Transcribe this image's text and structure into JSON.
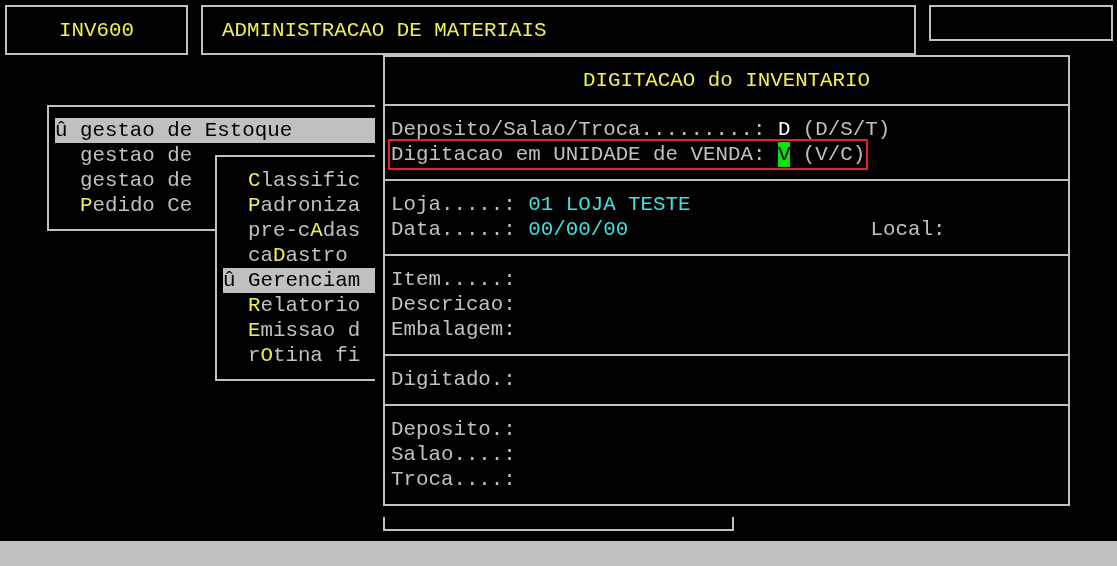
{
  "header": {
    "program_code": "INV600",
    "system_title": "ADMINISTRACAO DE MATERIAIS"
  },
  "menus": [
    {
      "marker": "û",
      "items": [
        {
          "text": "gestao de Estoque",
          "selected": true
        },
        {
          "text": "gestao de",
          "selected": false
        },
        {
          "text": "gestao de",
          "selected": false
        },
        {
          "text": "**P**edido Ce",
          "selected": false
        }
      ]
    },
    {
      "marker": "û",
      "items": [
        {
          "text": "**C**lassific",
          "selected": false
        },
        {
          "text": "**P**adroniza",
          "selected": false
        },
        {
          "text": "pre-c**A**das",
          "selected": false
        },
        {
          "text": "ca**D**astro",
          "selected": false
        },
        {
          "text": "Gerenciam",
          "selected": true
        },
        {
          "text": "**R**elatorio",
          "selected": false
        },
        {
          "text": "**E**missao d",
          "selected": false
        },
        {
          "text": "r**O**tina fi",
          "selected": false
        }
      ]
    }
  ],
  "dialog": {
    "title": "DIGITACAO do INVENTARIO",
    "sections": [
      {
        "rows": [
          {
            "kind": "option",
            "label": "Deposito/Salao/Troca.........:",
            "value": "D",
            "hint": "(D/S/T)",
            "focused": false
          },
          {
            "kind": "option",
            "label": "Digitacao em UNIDADE de VENDA:",
            "value": "V",
            "hint": "(V/C)",
            "focused": true
          }
        ]
      },
      {
        "rows": [
          {
            "kind": "data",
            "label": "Loja.....:",
            "value": "01 LOJA TESTE"
          },
          {
            "kind": "data",
            "label": "Data.....:",
            "value": "00/00/00",
            "side_label": "Local:"
          }
        ]
      },
      {
        "rows": [
          {
            "kind": "label",
            "label": "Item.....:"
          },
          {
            "kind": "label",
            "label": "Descricao:"
          },
          {
            "kind": "label",
            "label": "Embalagem:"
          }
        ]
      },
      {
        "rows": [
          {
            "kind": "label",
            "label": "Digitado.:"
          }
        ]
      },
      {
        "rows": [
          {
            "kind": "label",
            "label": "Deposito.:"
          },
          {
            "kind": "label",
            "label": "Salao....:"
          },
          {
            "kind": "label",
            "label": "Troca....:"
          }
        ]
      }
    ]
  }
}
